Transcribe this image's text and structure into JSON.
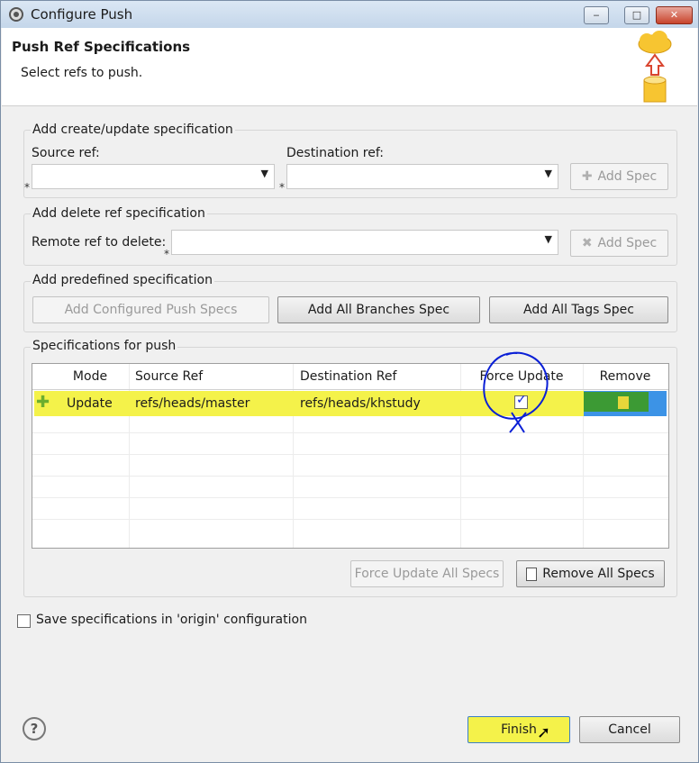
{
  "window": {
    "title": "Configure Push",
    "minimize": "‒",
    "maximize": "□",
    "close": "✕"
  },
  "header": {
    "title": "Push Ref Specifications",
    "description": "Select refs to push."
  },
  "create_update": {
    "group_label": "Add create/update specification",
    "source_label": "Source ref:",
    "source_value": "",
    "destination_label": "Destination ref:",
    "destination_value": "",
    "required_marker": "*",
    "add_spec": "Add Spec"
  },
  "delete_ref": {
    "group_label": "Add delete ref specification",
    "remote_label": "Remote ref to delete:",
    "remote_value": "",
    "add_spec": "Add Spec"
  },
  "predefined": {
    "group_label": "Add predefined specification",
    "configured": "Add Configured Push Specs",
    "all_branches": "Add All Branches Spec",
    "all_tags": "Add All Tags Spec"
  },
  "specs": {
    "group_label": "Specifications for push",
    "columns": [
      "Mode",
      "Source Ref",
      "Destination Ref",
      "Force Update",
      "Remove"
    ],
    "rows": [
      {
        "mode": "Update",
        "source": "refs/heads/master",
        "destination": "refs/heads/khstudy",
        "force_update": true
      }
    ],
    "force_update_all": "Force Update All Specs",
    "remove_all": "Remove All Specs"
  },
  "save_config": {
    "label": "Save specifications in 'origin' configuration",
    "checked": false
  },
  "footer": {
    "help": "?",
    "finish": "Finish",
    "cancel": "Cancel"
  },
  "colors": {
    "highlight": "#f4f24a",
    "annotation_ink": "#0a1fd6",
    "remove_cell": "#3c93e6"
  }
}
